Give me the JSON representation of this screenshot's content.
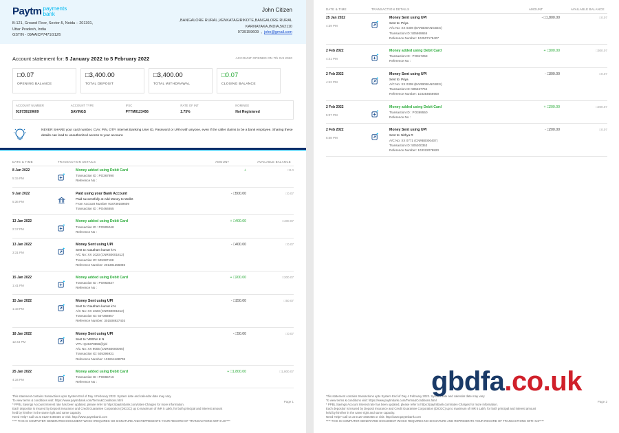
{
  "header": {
    "logo": {
      "paytm": "Paytm",
      "line1": "payments",
      "line2": "bank"
    },
    "bank_address": [
      "B-121, Ground Floor, Sector-5, Noida – 201301,",
      "Uttar Pradesh, India",
      "GSTIN - 09AAICP7471G1Z6"
    ],
    "customer_name": "John Citizen",
    "customer_address": [
      ",BANGALORE RURAL,VENKATAGIRIKOTE,BANGALORE RURAL",
      "KARNATAKA,INDIA,562110"
    ],
    "phone": "9739159609",
    "email": "john@gmail.com"
  },
  "statement": {
    "label": "Account statement for:",
    "period": "5 January 2022 to 5 February 2022",
    "opened": "ACCOUNT OPENED ON 7th Oct 2020"
  },
  "summary": [
    {
      "value": "□0.07",
      "label": "OPENING BALANCE",
      "green": false
    },
    {
      "value": "□3,400.00",
      "label": "TOTAL DEPOSIT",
      "green": false
    },
    {
      "value": "□3,400.00",
      "label": "TOTAL WITHDRAWAL",
      "green": false
    },
    {
      "value": "□0.07",
      "label": "CLOSING BALANCE",
      "green": true
    }
  ],
  "account_info": [
    {
      "head": "ACCOUNT NUMBER",
      "val": "919739159609"
    },
    {
      "head": "ACCOUNT TYPE",
      "val": "SAVINGS"
    },
    {
      "head": "IFSC",
      "val": "PYTM0123456"
    },
    {
      "head": "RATE OF INT",
      "val": "2.75%"
    },
    {
      "head": "NOMINEE",
      "val": "Not Registered"
    }
  ],
  "warning": "NEVER SHARE your card number, CVV, PIN, OTP, Internet Banking User ID, Password or URN with anyone, even if the caller claims to be a bank employee. Sharing these details can lead to unauthorized access to your account.",
  "columns": {
    "date": "DATE & TIME",
    "details": "TRANSACTION DETAILS",
    "amount": "AMOUNT",
    "balance": "AVAILABLE BALANCE"
  },
  "page1_rows": [
    {
      "date": "8 Jan 2022",
      "time": "5:15 PM",
      "icon": "wallet-add-icon",
      "title": "Money added using Debit Card",
      "green": true,
      "lines": [
        "Transaction ID : PO367890",
        "Reference No :"
      ],
      "amount": "+",
      "balance": "□0.0"
    },
    {
      "date": "9 Jan 2022",
      "time": "5:36 PM",
      "icon": "bank-icon",
      "title": "Paid using your Bank Account",
      "green": false,
      "sub": "Paid successfully at Add Money to Wallet",
      "lines": [
        "From Account Number 918739159609",
        "Transaction ID : PO464655"
      ],
      "amount": "- □500.00",
      "balance": "□0.07"
    },
    {
      "date": "13 Jan 2022",
      "time": "2:17 PM",
      "icon": "wallet-add-icon",
      "title": "Money added using Debit Card",
      "green": true,
      "lines": [
        "Transaction ID : PO905048",
        "Reference No :"
      ],
      "amount": "+ □400.00",
      "balance": "□400.07"
    },
    {
      "date": "13 Jan 2022",
      "time": "3:31 PM",
      "icon": "upi-send-icon",
      "title": "Money Sent using UPI",
      "green": false,
      "sub": "Sent to: Gautham kumar k N",
      "lines": [
        "A/C No: XX 1023 (CNRB0001812)",
        "Transaction ID: 505387188",
        "Reference Number: 201301256086"
      ],
      "amount": "- □400.00",
      "balance": "□0.07"
    },
    {
      "date": "15 Jan 2022",
      "time": "1:41 PM",
      "icon": "wallet-add-icon",
      "title": "Money added using Debit Card",
      "green": true,
      "lines": [
        "Transaction ID : PO963637",
        "Reference No :"
      ],
      "amount": "+ □200.00",
      "balance": "□200.07"
    },
    {
      "date": "15 Jan 2022",
      "time": "1:43 PM",
      "icon": "upi-send-icon",
      "title": "Money Sent using UPI",
      "green": false,
      "sub": "Sent to: Gautham kumar k N",
      "lines": [
        "A/C No: XX 1023 (CNRB0001812)",
        "Transaction ID: 507368857",
        "Reference Number: 301508927403"
      ],
      "amount": "- □150.00",
      "balance": "□50.07"
    },
    {
      "date": "18 Jan 2022",
      "time": "12:44 PM",
      "icon": "upi-send-icon",
      "title": "Money Sent using UPI",
      "green": false,
      "sub": "Sent to: VEENA K N",
      "lines": [
        "VPA: Q45378656@ybl",
        "A/C No: XX 9005 (CNRB0000005)",
        "Transaction ID: 505396931",
        "Reference Number: 101814468708"
      ],
      "amount": "- □50.00",
      "balance": "□0.07"
    },
    {
      "date": "25 Jan 2022",
      "time": "4:34 PM",
      "icon": "wallet-add-icon",
      "title": "Money added using Debit Card",
      "green": true,
      "lines": [
        "Transaction ID : PO865716",
        "Reference No :"
      ],
      "amount": "+ □1,800.00",
      "balance": "□1,800.07"
    }
  ],
  "page2_rows": [
    {
      "date": "25 Jan 2022",
      "time": "4:39 PM",
      "icon": "upi-send-icon",
      "title": "Money Sent using UPI",
      "green": false,
      "sub": "Sent to: Priya",
      "lines": [
        "A/C No: XX 0308 (BARB0BANGBES)",
        "Transaction ID: 505869655",
        "Reference Number: 102507178407"
      ],
      "amount": "- □1,800.00",
      "balance": "□0.07"
    },
    {
      "date": "2 Feb 2022",
      "time": "4:41 PM",
      "icon": "wallet-add-icon",
      "title": "Money added using Debit Card",
      "green": true,
      "lines": [
        "Transaction ID : PO947253",
        "Reference No :"
      ],
      "amount": "+ □300.00",
      "balance": "□300.07"
    },
    {
      "date": "2 Feb 2022",
      "time": "4:42 PM",
      "icon": "upi-send-icon",
      "title": "Money Sent using UPI",
      "green": false,
      "sub": "Sent to: Priya",
      "lines": [
        "A/C No: XX 0308 (BARB0BANGBES)",
        "Transaction ID: 505327764",
        "Reference Number: 103354656900"
      ],
      "amount": "- □300.00",
      "balance": "□0.07"
    },
    {
      "date": "2 Feb 2022",
      "time": "5:07 PM",
      "icon": "wallet-add-icon",
      "title": "Money added using Debit Card",
      "green": true,
      "lines": [
        "Transaction ID : PO369550",
        "Reference No :"
      ],
      "amount": "+ □200.00",
      "balance": "□200.07"
    },
    {
      "date": "2 Feb 2022",
      "time": "5:08 PM",
      "icon": "upi-send-icon",
      "title": "Money Sent using UPI",
      "green": false,
      "sub": "Sent to: Nithya R",
      "lines": [
        "A/C No: XX 0771 (CNRB0000407)",
        "Transaction ID: 505300353",
        "Reference Number: 103322078820"
      ],
      "amount": "- □200.00",
      "balance": "□0.07"
    }
  ],
  "footer": [
    "This statement contains transactions upto System End of Day 4 February 2022. System date and calendar date may vary.",
    "To view terms & conditions visit: https://www.paytmbank.com/Terms&Conditions.html",
    "* PPBL Savings Account Interest rate has been updated, please refer to https://paytmbank.com/rates-Charges for more information.",
    "Each depositor is insured by Deposit Insurance and Credit Guarantee Corporation (DICGC) up to maximum of INR 5 Lakh, for both principal and interest amount",
    "held by him/her in the same right and same capacity.",
    "Need Help? Call us at 0120-4456456 or visit: http://www.paytmbank.com",
    "**** THIS IS COMPUTER GENERATED DOCUMENT WHICH REQUIRES NO SIGNATURE AND REPRESENTS YOUR RECORD OF TRANSACTIONS WITH US****"
  ],
  "page_labels": [
    "Page 1",
    "Page 2"
  ],
  "watermark": {
    "part1": "gbdfa",
    "part2": ".co.uk"
  }
}
